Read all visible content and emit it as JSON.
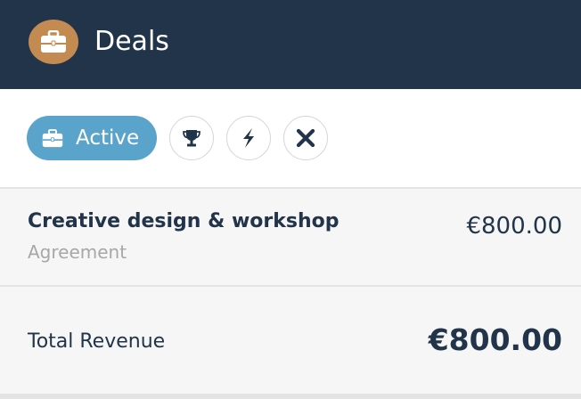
{
  "header": {
    "title": "Deals",
    "icon": "briefcase-icon",
    "accent": "#c38a52",
    "background": "#22344a"
  },
  "filters": {
    "active_label": "Active",
    "active_icon": "briefcase-icon",
    "active_color": "#5aa3cb",
    "buttons": [
      {
        "icon": "trophy-icon"
      },
      {
        "icon": "lightning-icon"
      },
      {
        "icon": "close-icon"
      }
    ]
  },
  "deals": [
    {
      "title": "Creative design & workshop",
      "subtitle": "Agreement",
      "amount": "€800.00"
    }
  ],
  "total": {
    "label": "Total Revenue",
    "amount": "€800.00"
  }
}
